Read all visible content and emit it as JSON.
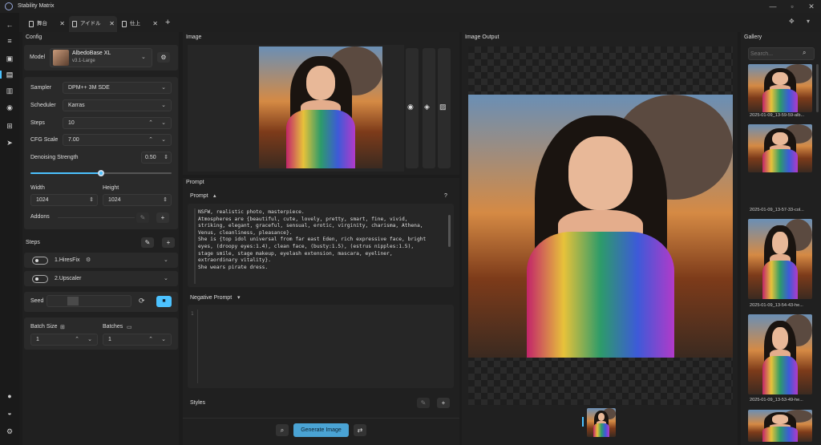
{
  "app": {
    "title": "Stability Matrix"
  },
  "tabs": [
    {
      "label": "舞台"
    },
    {
      "label": "アイドル"
    },
    {
      "label": "仕上"
    }
  ],
  "config": {
    "title": "Config",
    "model_label": "Model",
    "model_name": "AlbedoBase XL",
    "model_version": "v3.1-Large",
    "sampler_label": "Sampler",
    "sampler_value": "DPM++ 3M SDE",
    "scheduler_label": "Scheduler",
    "scheduler_value": "Karras",
    "steps_label": "Steps",
    "steps_value": "10",
    "cfg_label": "CFG Scale",
    "cfg_value": "7.00",
    "denoise_label": "Denoising Strength",
    "denoise_value": "0.50",
    "denoise_level": 0.5,
    "width_label": "Width",
    "width_value": "1024",
    "height_label": "Height",
    "height_value": "1024",
    "addons_label": "Addons",
    "steps_section_label": "Steps",
    "hiresfix_label": "1.HiresFix",
    "upscaler_label": "2.Upscaler",
    "seed_label": "Seed",
    "batch_size_label": "Batch Size",
    "batch_size_value": "1",
    "batches_label": "Batches",
    "batches_value": "1"
  },
  "image_panel": {
    "title": "Image"
  },
  "prompt_panel": {
    "title": "Prompt",
    "prompt_label": "Prompt",
    "help": "?",
    "prompt_lines": [
      "NSFW, realistic photo, masterpiece.",
      "Atmospheres are {beautiful, cute, lovely, pretty, smart, fine, vivid,",
      "striking, elegant, graceful, sensual, erotic, virginity, charisma, Athena,",
      "Venus, cleanliness, pleasance}.",
      "She is {top idol universal from far east Eden, rich expressive face, bright",
      "eyes, (droopy eyes:1.4), clean face, (busty:1.5), (estrus nipples:1.5),",
      "stage smile, stage makeup, eyelash extension, mascara, eyeliner,",
      "extraordinary vitality}.",
      "She wears pirate dress."
    ],
    "negative_label": "Negative Prompt",
    "negative_line_number": "1",
    "styles_label": "Styles",
    "generate_label": "Generate Image"
  },
  "output_panel": {
    "title": "Image Output"
  },
  "gallery": {
    "title": "Gallery",
    "search_placeholder": "Search...",
    "items": [
      {
        "caption": "2025-01-09_13-59-59-alb..."
      },
      {
        "caption": "2025-01-09_13-57-33-col..."
      },
      {
        "caption": "2025-01-09_13-54-43-he..."
      },
      {
        "caption": "2025-01-09_13-53-49-he..."
      }
    ]
  },
  "colors": {
    "accent": "#4cc2ff",
    "generate_button": "#4aa3d4"
  }
}
